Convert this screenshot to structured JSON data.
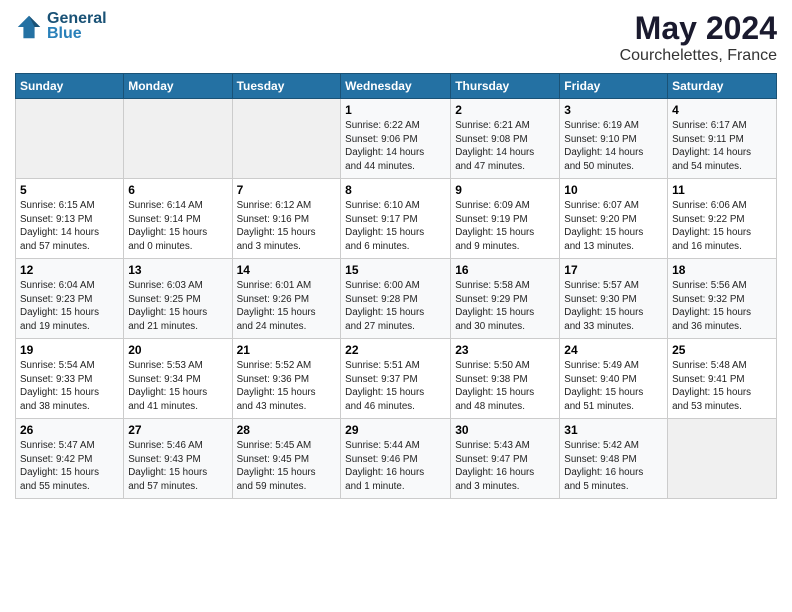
{
  "header": {
    "logo_line1": "General",
    "logo_line2": "Blue",
    "main_title": "May 2024",
    "sub_title": "Courchelettes, France"
  },
  "days_of_week": [
    "Sunday",
    "Monday",
    "Tuesday",
    "Wednesday",
    "Thursday",
    "Friday",
    "Saturday"
  ],
  "weeks": [
    [
      {
        "num": "",
        "info": ""
      },
      {
        "num": "",
        "info": ""
      },
      {
        "num": "",
        "info": ""
      },
      {
        "num": "1",
        "info": "Sunrise: 6:22 AM\nSunset: 9:06 PM\nDaylight: 14 hours\nand 44 minutes."
      },
      {
        "num": "2",
        "info": "Sunrise: 6:21 AM\nSunset: 9:08 PM\nDaylight: 14 hours\nand 47 minutes."
      },
      {
        "num": "3",
        "info": "Sunrise: 6:19 AM\nSunset: 9:10 PM\nDaylight: 14 hours\nand 50 minutes."
      },
      {
        "num": "4",
        "info": "Sunrise: 6:17 AM\nSunset: 9:11 PM\nDaylight: 14 hours\nand 54 minutes."
      }
    ],
    [
      {
        "num": "5",
        "info": "Sunrise: 6:15 AM\nSunset: 9:13 PM\nDaylight: 14 hours\nand 57 minutes."
      },
      {
        "num": "6",
        "info": "Sunrise: 6:14 AM\nSunset: 9:14 PM\nDaylight: 15 hours\nand 0 minutes."
      },
      {
        "num": "7",
        "info": "Sunrise: 6:12 AM\nSunset: 9:16 PM\nDaylight: 15 hours\nand 3 minutes."
      },
      {
        "num": "8",
        "info": "Sunrise: 6:10 AM\nSunset: 9:17 PM\nDaylight: 15 hours\nand 6 minutes."
      },
      {
        "num": "9",
        "info": "Sunrise: 6:09 AM\nSunset: 9:19 PM\nDaylight: 15 hours\nand 9 minutes."
      },
      {
        "num": "10",
        "info": "Sunrise: 6:07 AM\nSunset: 9:20 PM\nDaylight: 15 hours\nand 13 minutes."
      },
      {
        "num": "11",
        "info": "Sunrise: 6:06 AM\nSunset: 9:22 PM\nDaylight: 15 hours\nand 16 minutes."
      }
    ],
    [
      {
        "num": "12",
        "info": "Sunrise: 6:04 AM\nSunset: 9:23 PM\nDaylight: 15 hours\nand 19 minutes."
      },
      {
        "num": "13",
        "info": "Sunrise: 6:03 AM\nSunset: 9:25 PM\nDaylight: 15 hours\nand 21 minutes."
      },
      {
        "num": "14",
        "info": "Sunrise: 6:01 AM\nSunset: 9:26 PM\nDaylight: 15 hours\nand 24 minutes."
      },
      {
        "num": "15",
        "info": "Sunrise: 6:00 AM\nSunset: 9:28 PM\nDaylight: 15 hours\nand 27 minutes."
      },
      {
        "num": "16",
        "info": "Sunrise: 5:58 AM\nSunset: 9:29 PM\nDaylight: 15 hours\nand 30 minutes."
      },
      {
        "num": "17",
        "info": "Sunrise: 5:57 AM\nSunset: 9:30 PM\nDaylight: 15 hours\nand 33 minutes."
      },
      {
        "num": "18",
        "info": "Sunrise: 5:56 AM\nSunset: 9:32 PM\nDaylight: 15 hours\nand 36 minutes."
      }
    ],
    [
      {
        "num": "19",
        "info": "Sunrise: 5:54 AM\nSunset: 9:33 PM\nDaylight: 15 hours\nand 38 minutes."
      },
      {
        "num": "20",
        "info": "Sunrise: 5:53 AM\nSunset: 9:34 PM\nDaylight: 15 hours\nand 41 minutes."
      },
      {
        "num": "21",
        "info": "Sunrise: 5:52 AM\nSunset: 9:36 PM\nDaylight: 15 hours\nand 43 minutes."
      },
      {
        "num": "22",
        "info": "Sunrise: 5:51 AM\nSunset: 9:37 PM\nDaylight: 15 hours\nand 46 minutes."
      },
      {
        "num": "23",
        "info": "Sunrise: 5:50 AM\nSunset: 9:38 PM\nDaylight: 15 hours\nand 48 minutes."
      },
      {
        "num": "24",
        "info": "Sunrise: 5:49 AM\nSunset: 9:40 PM\nDaylight: 15 hours\nand 51 minutes."
      },
      {
        "num": "25",
        "info": "Sunrise: 5:48 AM\nSunset: 9:41 PM\nDaylight: 15 hours\nand 53 minutes."
      }
    ],
    [
      {
        "num": "26",
        "info": "Sunrise: 5:47 AM\nSunset: 9:42 PM\nDaylight: 15 hours\nand 55 minutes."
      },
      {
        "num": "27",
        "info": "Sunrise: 5:46 AM\nSunset: 9:43 PM\nDaylight: 15 hours\nand 57 minutes."
      },
      {
        "num": "28",
        "info": "Sunrise: 5:45 AM\nSunset: 9:45 PM\nDaylight: 15 hours\nand 59 minutes."
      },
      {
        "num": "29",
        "info": "Sunrise: 5:44 AM\nSunset: 9:46 PM\nDaylight: 16 hours\nand 1 minute."
      },
      {
        "num": "30",
        "info": "Sunrise: 5:43 AM\nSunset: 9:47 PM\nDaylight: 16 hours\nand 3 minutes."
      },
      {
        "num": "31",
        "info": "Sunrise: 5:42 AM\nSunset: 9:48 PM\nDaylight: 16 hours\nand 5 minutes."
      },
      {
        "num": "",
        "info": ""
      }
    ]
  ]
}
